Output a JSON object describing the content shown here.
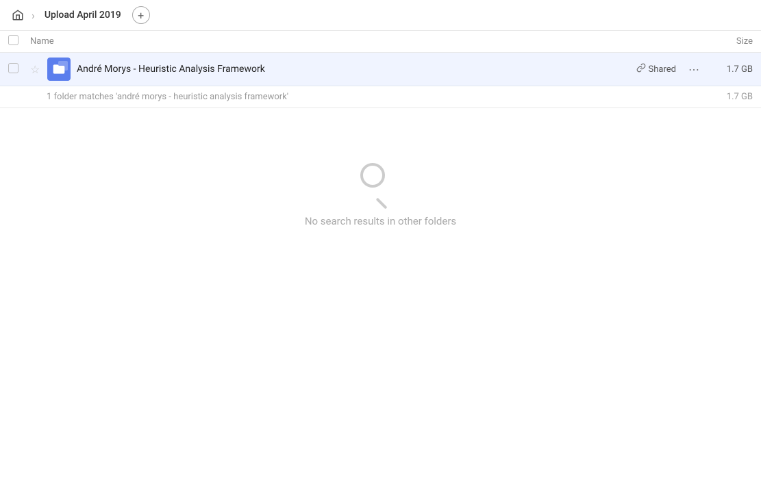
{
  "breadcrumb": {
    "home_icon": "🏠",
    "separator": "›",
    "current": "Upload April 2019",
    "add_icon": "+"
  },
  "columns": {
    "name_label": "Name",
    "size_label": "Size"
  },
  "file_row": {
    "file_name": "André Morys - Heuristic Analysis Framework",
    "shared_label": "Shared",
    "file_size": "1.7 GB",
    "more_icon": "⋯"
  },
  "summary": {
    "text": "1 folder matches 'andré morys - heuristic analysis framework'",
    "size": "1.7 GB"
  },
  "empty_state": {
    "message": "No search results in other folders"
  }
}
